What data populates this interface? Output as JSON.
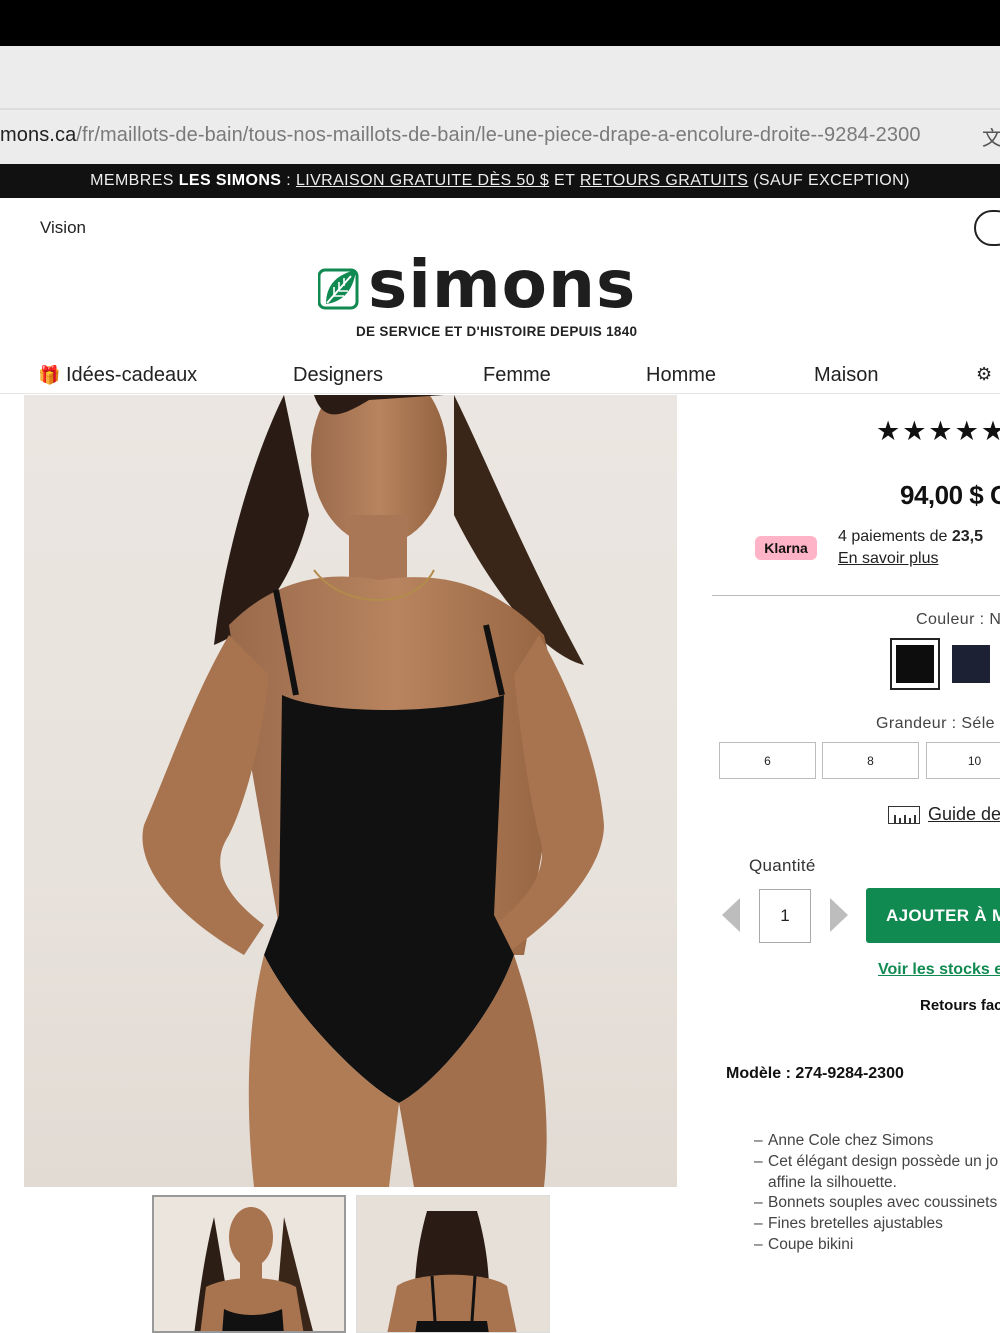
{
  "browser": {
    "url_host": "mons.ca",
    "url_path": "/fr/maillots-de-bain/tous-nos-maillots-de-bain/le-une-piece-drape-a-encolure-droite--9284-2300",
    "translate_icon": "文"
  },
  "promo": {
    "part1": "MEMBRES ",
    "brand": "LES SIMONS",
    "part2": " : ",
    "link1": "LIVRAISON GRATUITE DÈS 50 $",
    "part3": " ET ",
    "link2": "RETOURS GRATUITS",
    "part4": " (SAUF EXCEPTION)"
  },
  "header": {
    "vision_label": "Vision",
    "logo_text": "simons",
    "tagline": "DE SERVICE ET D'HISTOIRE DEPUIS 1840",
    "brand_color": "#118a52"
  },
  "nav": {
    "gift_icon": "🎁",
    "items": [
      "Idées-cadeaux",
      "Designers",
      "Femme",
      "Homme",
      "Maison"
    ],
    "extra_icon": "⚙"
  },
  "product": {
    "rating_stars": "★★★★★",
    "rating_value": 5,
    "price": "94,00 $ C",
    "klarna_badge": "Klarna",
    "klarna_text_prefix": "4 paiements de ",
    "klarna_amount": "23,5",
    "klarna_link": "En savoir plus",
    "color_label": "Couleur : N",
    "swatch_colors": [
      "#0d0d0d",
      "#1c2133"
    ],
    "size_label": "Grandeur : Séle",
    "sizes": [
      "6",
      "8",
      "10"
    ],
    "size_guide": "Guide de",
    "quantity_label": "Quantité",
    "quantity_value": "1",
    "add_to_cart": "AJOUTER À M",
    "stock_link": "Voir les stocks en",
    "returns": "Retours fac",
    "model": "Modèle : 274-9284-2300",
    "features": [
      "Anne Cole chez Simons",
      "Cet élégant design possède un jo",
      "affine la silhouette.",
      "Bonnets souples avec coussinets",
      "Fines bretelles ajustables",
      "Coupe bikini"
    ]
  }
}
